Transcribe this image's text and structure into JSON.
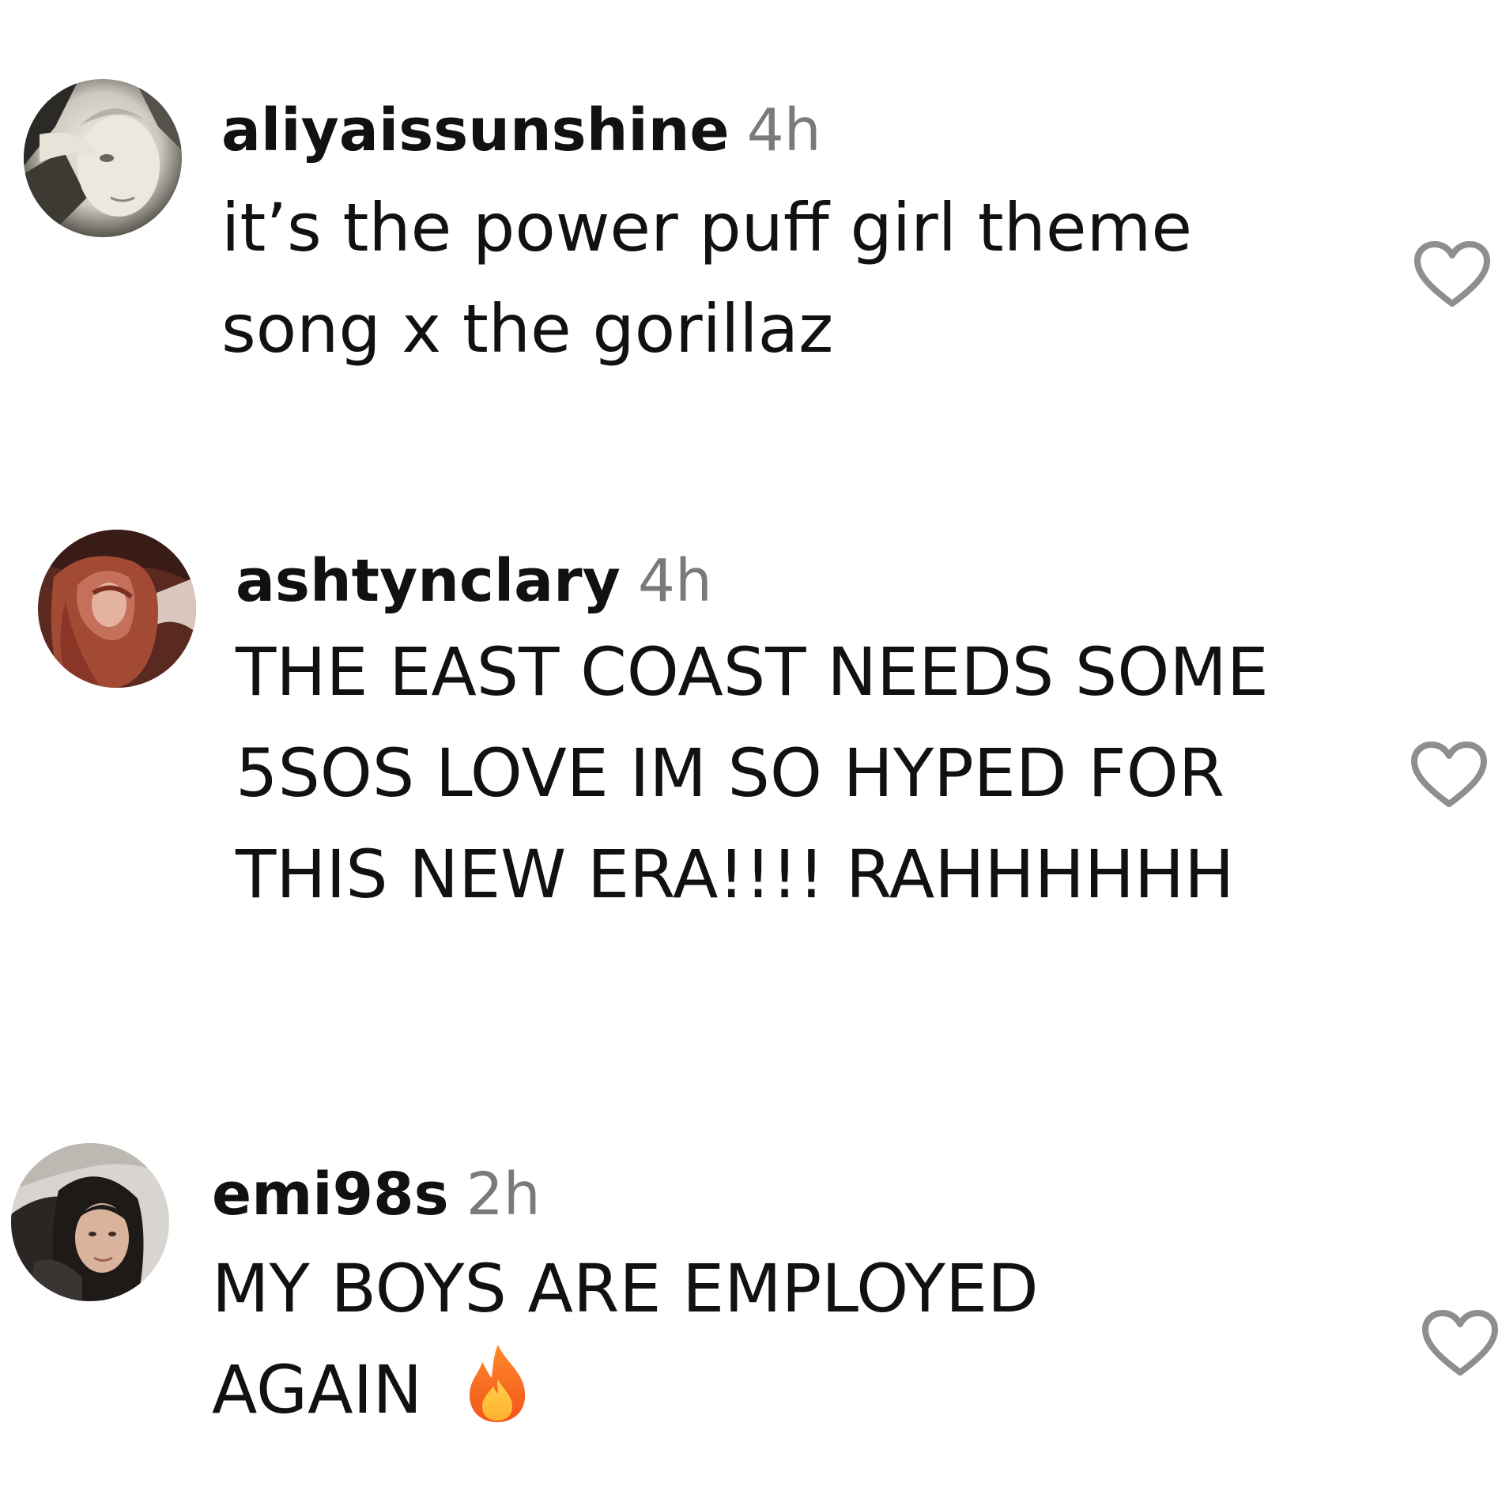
{
  "comments": [
    {
      "username": "aliyaissunshine",
      "time": "4h",
      "lines": [
        "it’s the power puff girl theme",
        "song x the gorillaz"
      ]
    },
    {
      "username": "ashtynclary",
      "time": "4h",
      "lines": [
        "THE EAST COAST NEEDS SOME",
        "5SOS LOVE IM SO HYPED FOR",
        "THIS NEW ERA!!!! RAHHHHHH"
      ]
    },
    {
      "username": "emi98s",
      "time": "2h",
      "lines": [
        "MY BOYS ARE EMPLOYED",
        "AGAIN"
      ],
      "emoji": "fire-emoji"
    }
  ],
  "icons": {
    "like": "heart-outline-icon",
    "emoji": "fire-icon"
  },
  "colors": {
    "text": "#111111",
    "timestamp": "#7a7a7a",
    "heart_outline": "#8e8e8e",
    "background": "#ffffff"
  }
}
